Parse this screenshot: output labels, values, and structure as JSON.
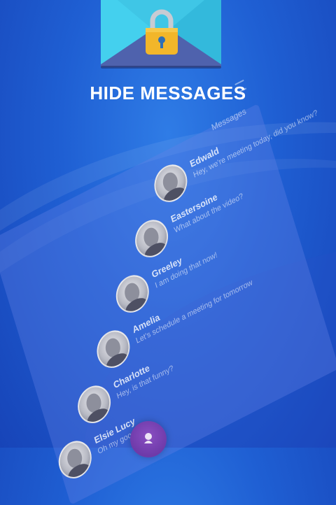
{
  "banner": {
    "title": "HIDE MESSAGES"
  },
  "screen": {
    "header": "Messages",
    "messages": [
      {
        "name": "Edwald",
        "text": "Hey, we're meeting today, did you know?"
      },
      {
        "name": "Eastersoine",
        "text": "What about the video?"
      },
      {
        "name": "Greeley",
        "text": "I am doing that now!"
      },
      {
        "name": "Amelia",
        "text": "Let's schedule a meeting for tomorrow"
      },
      {
        "name": "Charlotte",
        "text": "Hey, is that funny?"
      },
      {
        "name": "Elsie Lucy",
        "text": "Oh my goodness!"
      }
    ]
  },
  "colors": {
    "background": "#1f5fd3",
    "envelope_back": "#5d6fb8",
    "envelope_front": "#3fc6e6",
    "lock_body": "#f2b62a",
    "fab": "#7a45b5"
  },
  "icons": {
    "envelope": "envelope-icon",
    "lock": "lock-icon",
    "menu": "menu-icon",
    "fab": "compose-icon"
  }
}
